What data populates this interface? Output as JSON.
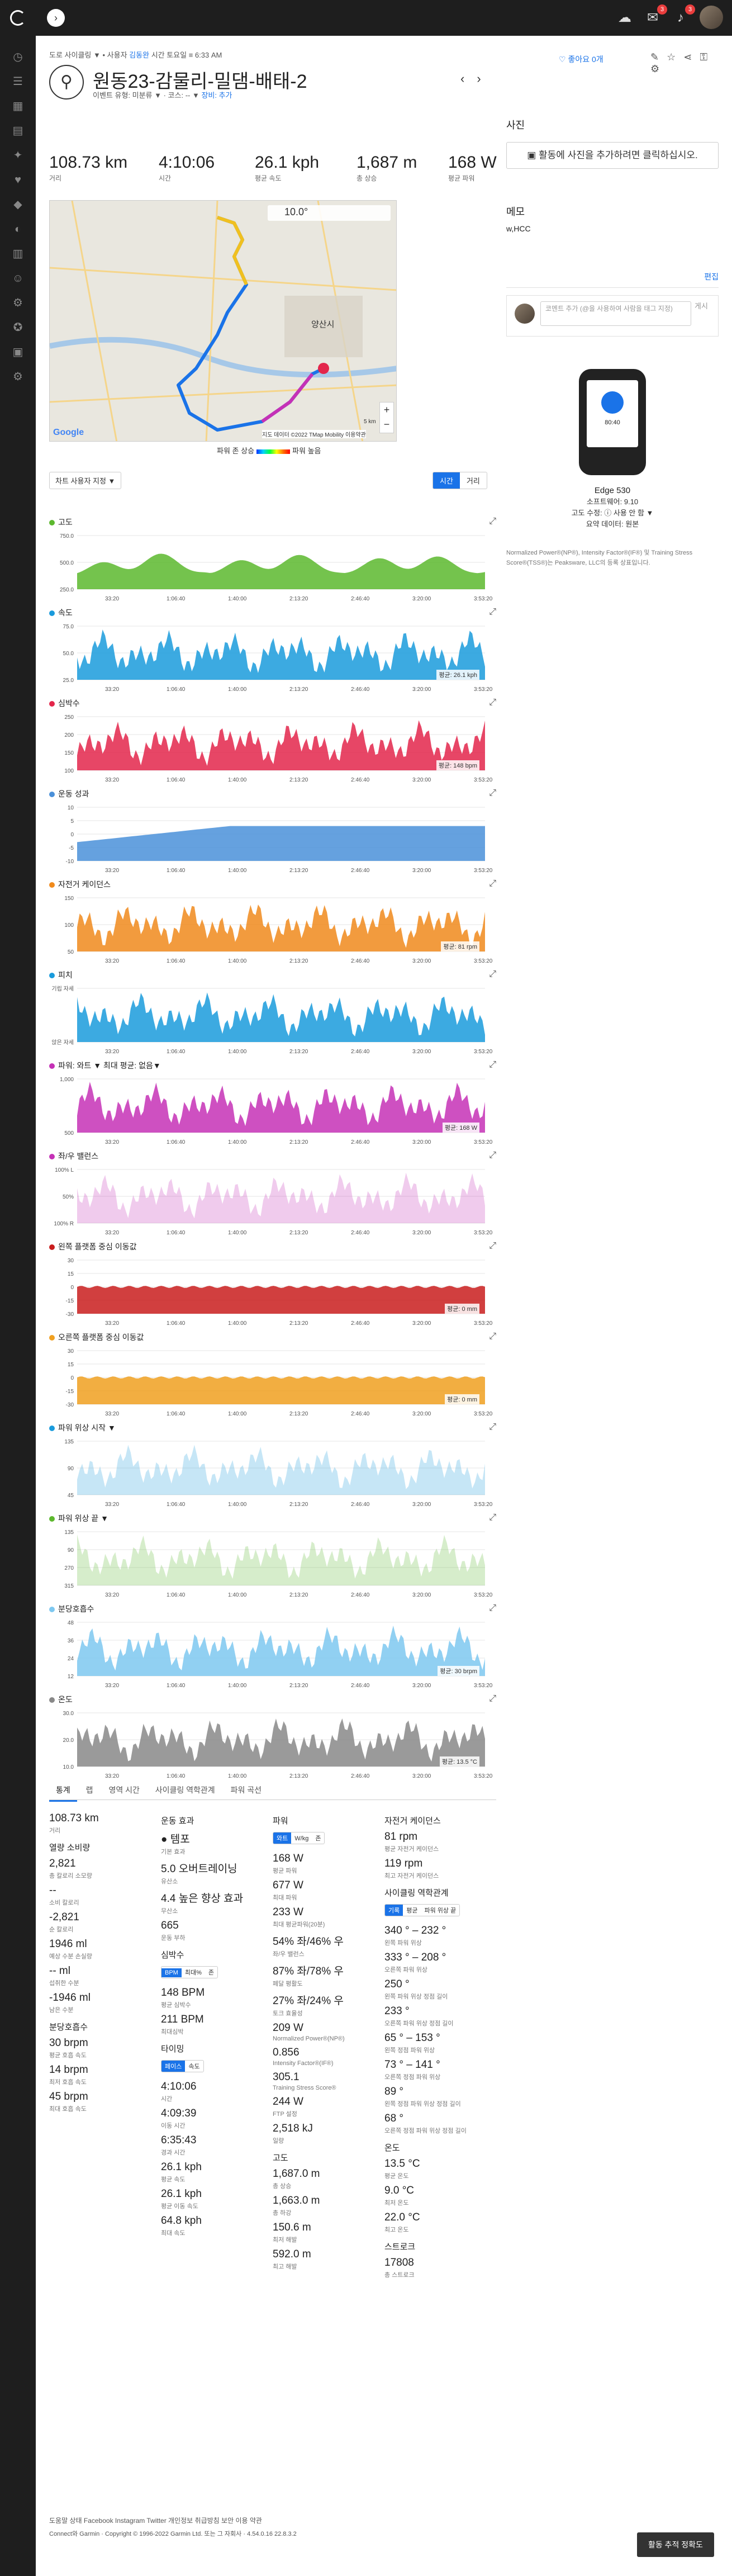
{
  "header": {
    "bell_badge": "3",
    "gear_badge": "3"
  },
  "breadcrumb": {
    "prefix": "도로 사이클링",
    "dropdown": "▼",
    "text1": "• 사용자",
    "linked": "김동완",
    "text2": "시간 토요일 ≡ 6:33 AM"
  },
  "activity": {
    "title": "원동23-감물리-밀댐-배태-2",
    "subline_prefix": "이벤트 유형: 미분류 ▼ · 코스: -- ▼",
    "gear_label": "장비: 추가",
    "like": "♡ 좋아요 0개"
  },
  "stats": [
    {
      "value": "108.73 km",
      "label": "거리"
    },
    {
      "value": "4:10:06",
      "label": "시간"
    },
    {
      "value": "26.1 kph",
      "label": "평균 속도"
    },
    {
      "value": "1,687 m",
      "label": "총 상승"
    },
    {
      "value": "168 W",
      "label": "평균 파워"
    }
  ],
  "map": {
    "temp": "10.0°",
    "place": "양산시",
    "copyright": "지도 데이터 ©2022 TMap Mobility  이용약관",
    "scale": "5 km",
    "legend_left": "파워 존 상승",
    "legend_right": "파워 높음",
    "google": "Google"
  },
  "controls": {
    "chart_select": "차트 사용자 지정 ▼",
    "toggle_time": "시간",
    "toggle_distance": "거리"
  },
  "charts": [
    {
      "title": "고도",
      "color": "#5cb82e",
      "y": [
        "750.0",
        "500.0",
        "250.0"
      ],
      "overlay": ""
    },
    {
      "title": "속도",
      "color": "#1a9bdc",
      "y": [
        "75.0",
        "50.0",
        "25.0"
      ],
      "overlay": "평균: 26.1 kph"
    },
    {
      "title": "심박수",
      "color": "#e3264b",
      "y": [
        "250",
        "200",
        "150",
        "100"
      ],
      "overlay": "평균: 148 bpm"
    },
    {
      "title": "운동 성과",
      "color": "#4a90d9",
      "y": [
        "10",
        "5",
        "0",
        "-5",
        "-10"
      ],
      "overlay": ""
    },
    {
      "title": "자전거 케이던스",
      "color": "#f08a1c",
      "y": [
        "150",
        "100",
        "50"
      ],
      "overlay": "평균: 81 rpm"
    },
    {
      "title": "피치",
      "color": "#1a9bdc",
      "y": [
        "기립 자세",
        "앉은 자세"
      ],
      "overlay": ""
    },
    {
      "title": "파워: 와트 ▼   최대 평균: 없음▼",
      "color": "#c531b6",
      "y": [
        "1,000",
        "500"
      ],
      "overlay": "평균: 168 W"
    },
    {
      "title": "좌/우 밸런스",
      "color": "#c531b6",
      "y": [
        "100% L",
        "50%",
        "100% R"
      ],
      "overlay": ""
    },
    {
      "title": "왼쪽 플랫폼 중심 이동값",
      "color": "#c91d1d",
      "y": [
        "30",
        "15",
        "0",
        "-15",
        "-30"
      ],
      "overlay": "평균: 0 mm"
    },
    {
      "title": "오른쪽 플랫폼 중심 이동값",
      "color": "#f0a020",
      "y": [
        "30",
        "15",
        "0",
        "-15",
        "-30"
      ],
      "overlay": "평균: 0 mm"
    },
    {
      "title": "파워 위상 시작 ▼",
      "color": "#1a9bdc",
      "y": [
        "135",
        "90",
        "45"
      ],
      "overlay": ""
    },
    {
      "title": "파워 위상 끝 ▼",
      "color": "#5cb82e",
      "y": [
        "135",
        "90",
        "270",
        "315"
      ],
      "overlay": ""
    },
    {
      "title": "분당호흡수",
      "color": "#7ec8f0",
      "y": [
        "48",
        "36",
        "24",
        "12"
      ],
      "overlay": "평균: 30 brpm"
    },
    {
      "title": "온도",
      "color": "#888888",
      "y": [
        "30.0",
        "20.0",
        "10.0"
      ],
      "overlay": "평균: 13.5 °C"
    }
  ],
  "chart_x_ticks": [
    "33:20",
    "1:06:40",
    "1:40:00",
    "2:13:20",
    "2:46:40",
    "3:20:00",
    "3:53:20"
  ],
  "tabs": [
    "통계",
    "랩",
    "영역 시간",
    "사이클링 역학관계",
    "파워 곡선"
  ],
  "stats_col1": [
    {
      "t": "sv",
      "v": "108.73 km"
    },
    {
      "t": "sl",
      "v": "거리"
    },
    {
      "t": "sec",
      "v": "열량 소비량"
    },
    {
      "t": "sv",
      "v": "2,821"
    },
    {
      "t": "sl",
      "v": "총 칼로리 소모량"
    },
    {
      "t": "sv",
      "v": "--"
    },
    {
      "t": "sl",
      "v": "소비 칼로리"
    },
    {
      "t": "sv",
      "v": "-2,821"
    },
    {
      "t": "sl",
      "v": "순 칼로리"
    },
    {
      "t": "sv",
      "v": "1946 ml"
    },
    {
      "t": "sl",
      "v": "예상 수분 손실량"
    },
    {
      "t": "sv",
      "v": "-- ml"
    },
    {
      "t": "sl",
      "v": "섭취한 수분"
    },
    {
      "t": "sv",
      "v": "-1946 ml"
    },
    {
      "t": "sl",
      "v": "남은 수분"
    },
    {
      "t": "sec",
      "v": "분당호흡수"
    },
    {
      "t": "sv",
      "v": "30 brpm"
    },
    {
      "t": "sl",
      "v": "평균 호흡 속도"
    },
    {
      "t": "sv",
      "v": "14 brpm"
    },
    {
      "t": "sl",
      "v": "최저 호흡 속도"
    },
    {
      "t": "sv",
      "v": "45 brpm"
    },
    {
      "t": "sl",
      "v": "최대 호흡 속도"
    }
  ],
  "stats_col2": [
    {
      "t": "sec",
      "v": "운동 효과"
    },
    {
      "t": "sv",
      "v": "● 템포"
    },
    {
      "t": "sl",
      "v": "기본 효과"
    },
    {
      "t": "sv",
      "v": "5.0 오버트레이닝"
    },
    {
      "t": "sl",
      "v": "유산소"
    },
    {
      "t": "sv",
      "v": "4.4 높은 향상 효과"
    },
    {
      "t": "sl",
      "v": "무산소"
    },
    {
      "t": "sv",
      "v": "665"
    },
    {
      "t": "sl",
      "v": "운동 부하"
    },
    {
      "t": "sec",
      "v": "심박수"
    },
    {
      "t": "tog",
      "v": "BPM|최대%|존"
    },
    {
      "t": "sv",
      "v": "148 BPM"
    },
    {
      "t": "sl",
      "v": "평균 심박수"
    },
    {
      "t": "sv",
      "v": "211 BPM"
    },
    {
      "t": "sl",
      "v": "최대심박"
    },
    {
      "t": "sec",
      "v": "타이밍"
    },
    {
      "t": "tog",
      "v": "페이스|속도"
    },
    {
      "t": "sv",
      "v": "4:10:06"
    },
    {
      "t": "sl",
      "v": "시간"
    },
    {
      "t": "sv",
      "v": "4:09:39"
    },
    {
      "t": "sl",
      "v": "이동 시간"
    },
    {
      "t": "sv",
      "v": "6:35:43"
    },
    {
      "t": "sl",
      "v": "경과 시간"
    },
    {
      "t": "sv",
      "v": "26.1 kph"
    },
    {
      "t": "sl",
      "v": "평균 속도"
    },
    {
      "t": "sv",
      "v": "26.1 kph"
    },
    {
      "t": "sl",
      "v": "평균 이동 속도"
    },
    {
      "t": "sv",
      "v": "64.8 kph"
    },
    {
      "t": "sl",
      "v": "최대 속도"
    }
  ],
  "stats_col3": [
    {
      "t": "sec",
      "v": "파워"
    },
    {
      "t": "tog",
      "v": "와트|W/kg|존"
    },
    {
      "t": "sv",
      "v": "168 W"
    },
    {
      "t": "sl",
      "v": "평균 파워"
    },
    {
      "t": "sv",
      "v": "677 W"
    },
    {
      "t": "sl",
      "v": "최대 파워"
    },
    {
      "t": "sv",
      "v": "233 W"
    },
    {
      "t": "sl",
      "v": "최대 평균파워(20분)"
    },
    {
      "t": "sv",
      "v": "54% 좌/46% 우"
    },
    {
      "t": "sl",
      "v": "좌/우 밸런스"
    },
    {
      "t": "sv",
      "v": "87% 좌/78% 우"
    },
    {
      "t": "sl",
      "v": "페달 평활도"
    },
    {
      "t": "sv",
      "v": "27% 좌/24% 우"
    },
    {
      "t": "sl",
      "v": "토크 효율성"
    },
    {
      "t": "sv",
      "v": "209 W"
    },
    {
      "t": "sl",
      "v": "Normalized Power®(NP®)"
    },
    {
      "t": "sv",
      "v": "0.856"
    },
    {
      "t": "sl",
      "v": "Intensity Factor®(IF®)"
    },
    {
      "t": "sv",
      "v": "305.1"
    },
    {
      "t": "sl",
      "v": "Training Stress Score®"
    },
    {
      "t": "sv",
      "v": "244 W"
    },
    {
      "t": "sl",
      "v": "FTP 설정"
    },
    {
      "t": "sv",
      "v": "2,518 kJ"
    },
    {
      "t": "sl",
      "v": "일량"
    },
    {
      "t": "sec",
      "v": "고도"
    },
    {
      "t": "sv",
      "v": "1,687.0 m"
    },
    {
      "t": "sl",
      "v": "총 상승"
    },
    {
      "t": "sv",
      "v": "1,663.0 m"
    },
    {
      "t": "sl",
      "v": "총 하강"
    },
    {
      "t": "sv",
      "v": "150.6 m"
    },
    {
      "t": "sl",
      "v": "최저 해발"
    },
    {
      "t": "sv",
      "v": "592.0 m"
    },
    {
      "t": "sl",
      "v": "최고 해발"
    }
  ],
  "stats_col4": [
    {
      "t": "sec",
      "v": "자전거 케이던스"
    },
    {
      "t": "sv",
      "v": "81 rpm"
    },
    {
      "t": "sl",
      "v": "평균 자전거 케이던스"
    },
    {
      "t": "sv",
      "v": "119 rpm"
    },
    {
      "t": "sl",
      "v": "최고 자전거 케이던스"
    },
    {
      "t": "sec",
      "v": "사이클링 역학관계"
    },
    {
      "t": "tog",
      "v": "기록|평균|파워 위상 끝"
    },
    {
      "t": "sv",
      "v": "340 ° – 232 °"
    },
    {
      "t": "sl",
      "v": "왼쪽 파워 위상"
    },
    {
      "t": "sv",
      "v": "333 ° – 208 °"
    },
    {
      "t": "sl",
      "v": "오른쪽 파워 위상"
    },
    {
      "t": "sv",
      "v": "250 °"
    },
    {
      "t": "sl",
      "v": "왼쪽 파워 위상 정점 길이"
    },
    {
      "t": "sv",
      "v": "233 °"
    },
    {
      "t": "sl",
      "v": "오른쪽 파워 위상 정점 길이"
    },
    {
      "t": "sv",
      "v": "65 ° – 153 °"
    },
    {
      "t": "sl",
      "v": "왼쪽 정점 파워 위상"
    },
    {
      "t": "sv",
      "v": "73 ° – 141 °"
    },
    {
      "t": "sl",
      "v": "오른쪽 정점 파워 위상"
    },
    {
      "t": "sv",
      "v": "89 °"
    },
    {
      "t": "sl",
      "v": "왼쪽 정점 파워 위상 정점 길이"
    },
    {
      "t": "sv",
      "v": "68 °"
    },
    {
      "t": "sl",
      "v": "오른쪽 정점 파워 위상 정점 길이"
    },
    {
      "t": "sec",
      "v": "온도"
    },
    {
      "t": "sv",
      "v": "13.5 °C"
    },
    {
      "t": "sl",
      "v": "평균 온도"
    },
    {
      "t": "sv",
      "v": "9.0 °C"
    },
    {
      "t": "sl",
      "v": "최저 온도"
    },
    {
      "t": "sv",
      "v": "22.0 °C"
    },
    {
      "t": "sl",
      "v": "최고 온도"
    },
    {
      "t": "sec",
      "v": "스트로크"
    },
    {
      "t": "sv",
      "v": "17808"
    },
    {
      "t": "sl",
      "v": "총 스트로크"
    }
  ],
  "right": {
    "photos_title": "사진",
    "add_photo": "활동에 사진을 추가하려면 클릭하십시오.",
    "memo_title": "메모",
    "memo_text": "w,HCC",
    "edit": "편집",
    "comment_placeholder": "코멘트 추가 (@을 사용하여 사람을 태그 지정)",
    "comment_post": "게시",
    "device_name": "Edge 530",
    "software": "소프트웨어: 9.10",
    "elevation_fix": "고도 수정: ⓘ 사용 안 함 ▼",
    "summary_data": "요약 데이터: 원본",
    "power_note": "Normalized Power®(NP®), Intensity Factor®(IF®) 및 Training Stress Score®(TSS®)는 Peaksware, LLC의 등록 상표입니다.",
    "device_screen": "80:40"
  },
  "footer": {
    "links": "도움말   상태   Facebook   Instagram   Twitter   개인정보 취급방침   보안   이용 약관",
    "copyright": "Connect와 Garmin · Copyright © 1996-2022 Garmin Ltd. 또는 그 자회사 · 4.54.0.16 22.8.3.2",
    "feedback": "활동 추적 정확도"
  }
}
